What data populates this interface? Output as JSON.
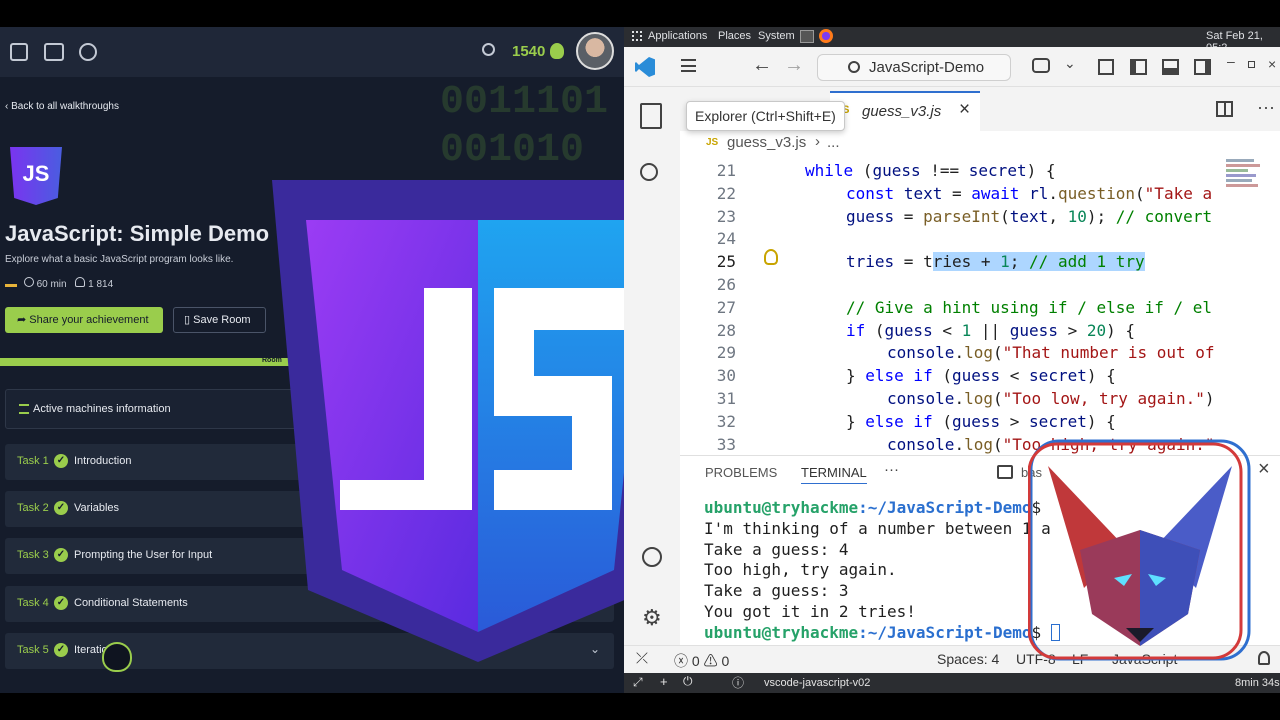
{
  "thm": {
    "points": "1540",
    "back_link": "Back to all walkthroughs",
    "room_title": "JavaScript: Simple Demo",
    "room_subtitle": "Explore what a basic JavaScript program looks like.",
    "duration": "60 min",
    "users": "1 814",
    "share_button": "Share your achievement",
    "save_button": "Save Room",
    "progress_label": "Room",
    "active_machines": "Active machines information",
    "binary_text": "0011101\n001010\n",
    "logo_text": "JS",
    "tasks": [
      {
        "num": "Task 1",
        "title": "Introduction"
      },
      {
        "num": "Task 2",
        "title": "Variables"
      },
      {
        "num": "Task 3",
        "title": "Prompting the User for Input"
      },
      {
        "num": "Task 4",
        "title": "Conditional Statements"
      },
      {
        "num": "Task 5",
        "title": "Iteratio"
      }
    ],
    "colors": {
      "accent": "#9acd4c",
      "panel": "#151c2b",
      "card": "#212a3a"
    }
  },
  "desktop": {
    "menu": [
      "Applications",
      "Places",
      "System"
    ],
    "clock": "Sat Feb 21, 05:2"
  },
  "vscode": {
    "search_text": "JavaScript-Demo",
    "tooltip": "Explorer (Ctrl+Shift+E)",
    "tab_label": "guess_v3.js",
    "breadcrumb_file": "guess_v3.js",
    "breadcrumb_more": "...",
    "file_icon": "JS",
    "code_lines": [
      {
        "n": "21",
        "indent": 0,
        "html": "<span class='kw'>while</span> (<span class='var'>guess</span> !== <span class='var'>secret</span>) {"
      },
      {
        "n": "22",
        "indent": 1,
        "html": "<span class='kw'>const</span> <span class='var'>text</span> = <span class='kw'>await</span> <span class='var'>rl</span>.<span class='fn'>question</span>(<span class='str'>\"Take a</span>"
      },
      {
        "n": "23",
        "indent": 1,
        "html": "<span class='var'>guess</span> = <span class='fn'>parseInt</span>(<span class='var'>text</span>, <span class='num'>10</span>); <span class='cm'>// convert</span>"
      },
      {
        "n": "24",
        "indent": 1,
        "html": ""
      },
      {
        "n": "25",
        "indent": 1,
        "html": "<span class='var'>tries</span> = t<span style='background:#add6ff'>ries + <span class='num'>1</span>; <span class='cm'>// add 1 try</span></span>"
      },
      {
        "n": "26",
        "indent": 1,
        "html": ""
      },
      {
        "n": "27",
        "indent": 1,
        "html": "<span class='cm'>// Give a hint using if / else if / el</span>"
      },
      {
        "n": "28",
        "indent": 1,
        "html": "<span class='kw'>if</span> (<span class='var'>guess</span> &lt; <span class='num'>1</span> || <span class='var'>guess</span> &gt; <span class='num'>20</span>) {"
      },
      {
        "n": "29",
        "indent": 2,
        "html": "<span class='var'>console</span>.<span class='fn'>log</span>(<span class='str'>\"That number is out of</span>"
      },
      {
        "n": "30",
        "indent": 1,
        "html": "} <span class='kw'>else if</span> (<span class='var'>guess</span> &lt; <span class='var'>secret</span>) {"
      },
      {
        "n": "31",
        "indent": 2,
        "html": "<span class='var'>console</span>.<span class='fn'>log</span>(<span class='str'>\"Too low, try again.\"</span>)"
      },
      {
        "n": "32",
        "indent": 1,
        "html": "} <span class='kw'>else if</span> (<span class='var'>guess</span> &gt; <span class='var'>secret</span>) {"
      },
      {
        "n": "33",
        "indent": 2,
        "html": "<span class='var'>console</span>.<span class='fn'>log</span>(<span class='str'>\"Too high, try again.\"</span>"
      }
    ],
    "panel_tabs": [
      "PROBLEMS",
      "TERMINAL"
    ],
    "panel_more": "···",
    "terminal_shell": "bas",
    "terminal_prompt_user": "ubuntu@tryhackme",
    "terminal_prompt_path": ":~/JavaScript-Demo",
    "terminal_lines": [
      "I'm thinking of a number between 1 a",
      "Take a guess: 4",
      "Too high, try again.",
      "Take a guess: 3",
      "You got it in 2 tries!"
    ],
    "status": {
      "errors": "0",
      "warnings": "0",
      "spaces": "Spaces: 4",
      "encoding": "UTF-8",
      "eol": "LF",
      "language": "JavaScript"
    }
  },
  "taskbar": {
    "item": "vscode-javascript-v02",
    "timer": "8min 34s"
  }
}
